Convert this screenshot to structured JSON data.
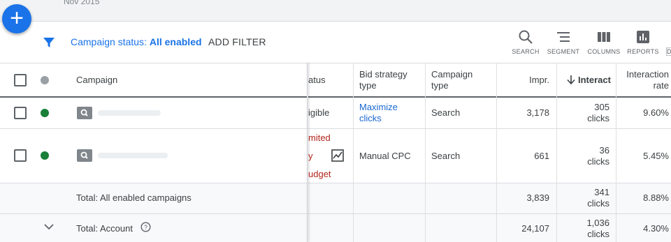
{
  "top": {
    "date": "Nov 2015"
  },
  "fab": {
    "label": "+"
  },
  "filter": {
    "status_prefix": "Campaign status: ",
    "status_value": "All enabled",
    "add_filter": "ADD FILTER"
  },
  "toolbar": {
    "search": "SEARCH",
    "segment": "SEGMENT",
    "columns": "COLUMNS",
    "reports": "REPORTS",
    "cut": "D"
  },
  "headers": {
    "campaign": "Campaign",
    "status": "atus",
    "bid1": "Bid strategy",
    "bid2": "type",
    "ctype1": "Campaign",
    "ctype2": "type",
    "impr": "Impr.",
    "interact": "Interact",
    "irate1": "Interaction",
    "irate2": "rate"
  },
  "rows": [
    {
      "status": "igible",
      "bid1": "Maximize",
      "bid2": "clicks",
      "ctype": "Search",
      "impr": "3,178",
      "int1": "305",
      "int2": "clicks",
      "rate": "9.60%"
    },
    {
      "status1": "mited",
      "status2": "y",
      "status3": "udget",
      "bid": "Manual CPC",
      "ctype": "Search",
      "impr": "661",
      "int1": "36",
      "int2": "clicks",
      "rate": "5.45%"
    }
  ],
  "totals": {
    "enabled": {
      "label": "Total: All enabled campaigns",
      "impr": "3,839",
      "int1": "341",
      "int2": "clicks",
      "rate": "8.88%"
    },
    "account": {
      "label": "Total: Account",
      "impr": "24,107",
      "int1": "1,036",
      "int2": "clicks",
      "rate": "4.30%"
    }
  },
  "colors": {
    "enabled_dot": "#188038",
    "header_dot": "#9aa0a6",
    "link": "#1967d2",
    "limited": "#b3261e"
  }
}
